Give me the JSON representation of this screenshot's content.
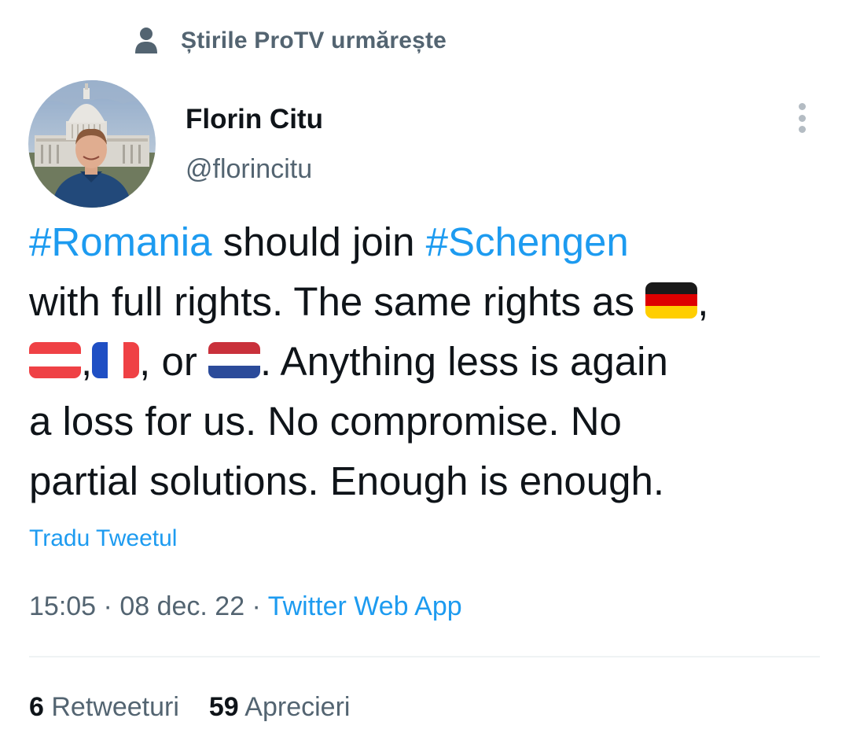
{
  "social_context": {
    "icon": "person-icon",
    "text": "Știrile ProTV urmărește"
  },
  "author": {
    "display_name": "Florin Citu",
    "handle": "@florincitu",
    "avatar_icon": "avatar-photo"
  },
  "more_icon": "more-vertical-icon",
  "tweet": {
    "hashtag_romania": "#Romania",
    "text_1": " should join ",
    "hashtag_schengen": "#Schengen",
    "text_2": "with full rights. The same rights as ",
    "text_3": ",",
    "text_4": ",",
    "text_5": ", or ",
    "text_6": ". Anything less is again",
    "text_7": "a loss for us. No compromise. No",
    "text_8": "partial solutions. Enough is enough.",
    "flags": [
      "germany-flag-icon",
      "austria-flag-icon",
      "france-flag-icon",
      "netherlands-flag-icon"
    ]
  },
  "translate_label": "Tradu Tweetul",
  "meta": {
    "time": "15:05",
    "separator": " · ",
    "date": "08 dec. 22",
    "source": "Twitter Web App"
  },
  "stats": {
    "retweets_count": "6",
    "retweets_label": " Retweeturi",
    "likes_count": "59",
    "likes_label": " Aprecieri"
  },
  "colors": {
    "link": "#1d9bf0",
    "secondary_text": "#536471",
    "primary_text": "#0f1419",
    "divider": "#eff3f4"
  }
}
